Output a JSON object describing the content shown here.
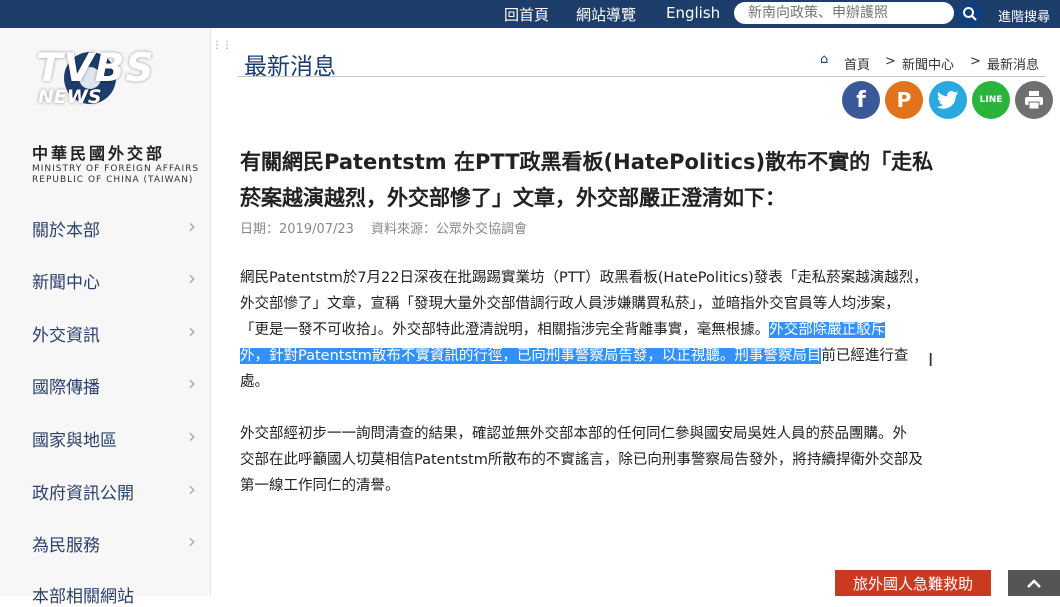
{
  "topnav": {
    "home": "回首頁",
    "sitemap": "網站導覽",
    "english": "English",
    "search_placeholder": "新南向政策、申辦護照",
    "advanced": "進階搜尋"
  },
  "watermark": {
    "tvbs": "TVBS",
    "news": "NEWS"
  },
  "logo": {
    "zh": "中華民國外交部",
    "en_line1": "MINISTRY OF FOREIGN AFFAIRS",
    "en_line2": "REPUBLIC OF CHINA (TAIWAN)"
  },
  "sidebar": {
    "items": [
      {
        "label": "關於本部"
      },
      {
        "label": "新聞中心"
      },
      {
        "label": "外交資訊"
      },
      {
        "label": "國際傳播"
      },
      {
        "label": "國家與地區"
      },
      {
        "label": "政府資訊公開"
      },
      {
        "label": "為民服務"
      },
      {
        "label": "本部相關網站"
      }
    ]
  },
  "main": {
    "title": "最新消息",
    "breadcrumb": {
      "home": "首頁",
      "sep": ">",
      "news_center": "新聞中心",
      "current": "最新消息"
    },
    "share": {
      "facebook": "f",
      "plurk": "P",
      "line": "LINE"
    },
    "article": {
      "headline_line1": "有關網民Patentstm 在PTT政黑看板(HatePolitics)散布不實的「走私",
      "headline_line2": "菸案越演越烈，外交部慘了」文章，外交部嚴正澄清如下：",
      "date": "日期：2019/07/23　 資料來源：公眾外交協調會",
      "p1_line1": "網民Patentstm於7月22日深夜在批踢踢實業坊（PTT）政黑看板(HatePolitics)發表「走私菸案越演越烈，",
      "p1_line2": "外交部慘了」文章，宣稱「發現大量外交部借調行政人員涉嫌購買私菸」，並暗指外交官員等人均涉案，",
      "p1_line3_plain": "「更是一發不可收拾」。外交部特此澄清說明，相關指涉完全背離事實，毫無根據。",
      "p1_line3_hl": "外交部除嚴正駁斥",
      "p1_line4_hl": "外，針對Patentstm散布不實資訊的行徑，已向刑事警察局告發，以正視聽。刑事警察局目",
      "p1_line4_plain": "前已經進行查",
      "p1_line5": "處。",
      "p2_line1": "外交部經初步一一詢問清查的結果，確認並無外交部本部的任何同仁參與國安局吳姓人員的菸品團購。外",
      "p2_line2": "交部在此呼籲國人切莫相信Patentstm所散布的不實謠言，除已向刑事警察局告發外，將持續捍衛外交部及",
      "p2_line3": "第一線工作同仁的清譽。"
    }
  },
  "footer": {
    "emergency": "旅外國人急難救助"
  },
  "colors": {
    "topbar": "#1d3d6b",
    "accent": "#1d3d6b",
    "highlight": "#3390ff",
    "emergency": "#c93a21"
  }
}
